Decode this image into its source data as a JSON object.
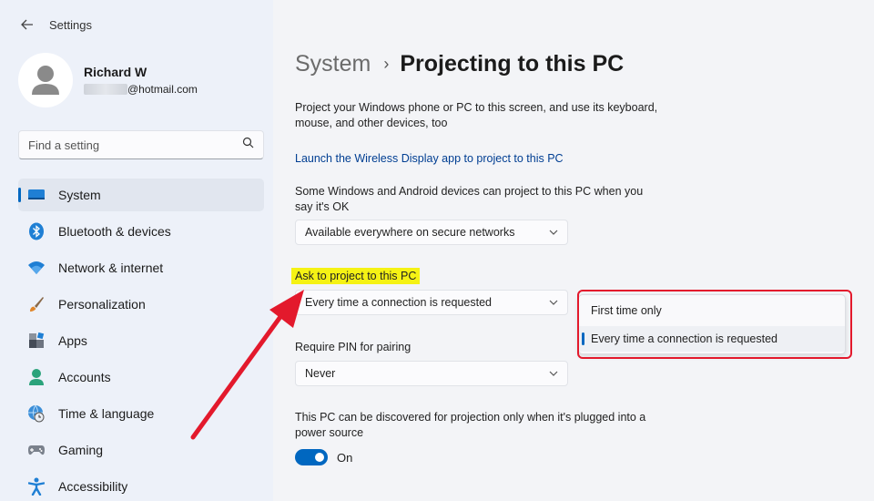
{
  "window": {
    "title": "Settings"
  },
  "user": {
    "name": "Richard W",
    "email_visible": "@hotmail.com"
  },
  "search": {
    "placeholder": "Find a setting"
  },
  "nav": {
    "items": [
      {
        "label": "System",
        "icon": "monitor-icon",
        "active": true
      },
      {
        "label": "Bluetooth & devices",
        "icon": "bluetooth-icon"
      },
      {
        "label": "Network & internet",
        "icon": "wifi-icon"
      },
      {
        "label": "Personalization",
        "icon": "paintbrush-icon"
      },
      {
        "label": "Apps",
        "icon": "apps-icon"
      },
      {
        "label": "Accounts",
        "icon": "person-icon"
      },
      {
        "label": "Time & language",
        "icon": "globe-clock-icon"
      },
      {
        "label": "Gaming",
        "icon": "gamepad-icon"
      },
      {
        "label": "Accessibility",
        "icon": "accessibility-icon"
      }
    ]
  },
  "page": {
    "breadcrumb_parent": "System",
    "breadcrumb_current": "Projecting to this PC",
    "intro": "Project your Windows phone or PC to this screen, and use its keyboard, mouse, and other devices, too",
    "launch_link": "Launch the Wireless Display app to project to this PC",
    "availability_desc": "Some Windows and Android devices can project to this PC when you say it's OK",
    "availability_value": "Available everywhere on secure networks",
    "ask_label": "Ask to project to this PC",
    "ask_value": "Every time a connection is requested",
    "pin_label": "Require PIN for pairing",
    "pin_value": "Never",
    "power_desc": "This PC can be discovered for projection only when it's plugged into a power source",
    "power_toggle_label": "On",
    "power_toggle_on": true
  },
  "ask_dropdown_options": [
    {
      "label": "First time only",
      "selected": false
    },
    {
      "label": "Every time a connection is requested",
      "selected": true
    }
  ],
  "colors": {
    "accent": "#0067c0",
    "highlight": "#f5f214",
    "annotation_red": "#e3192c",
    "link": "#003e92"
  }
}
